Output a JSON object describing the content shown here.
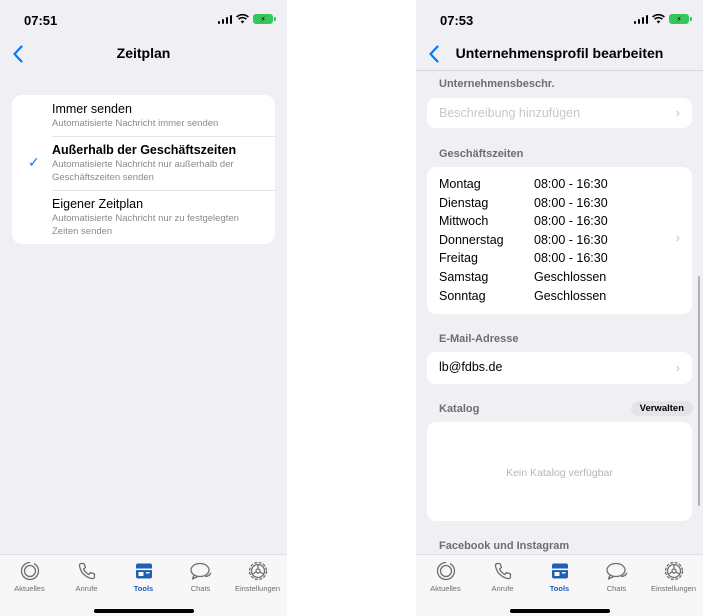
{
  "left": {
    "status": {
      "time": "07:51"
    },
    "nav": {
      "title": "Zeitplan"
    },
    "options": [
      {
        "title": "Immer senden",
        "desc": "Automatisierte Nachricht immer senden",
        "selected": false
      },
      {
        "title": "Außerhalb der Geschäftszeiten",
        "desc": "Automatisierte Nachricht nur außerhalb der Geschäftszeiten senden",
        "selected": true
      },
      {
        "title": "Eigener Zeitplan",
        "desc": "Automatisierte Nachricht nur zu festgelegten Zeiten senden",
        "selected": false
      }
    ]
  },
  "right": {
    "status": {
      "time": "07:53"
    },
    "nav": {
      "title": "Unternehmensprofil bearbeiten"
    },
    "description": {
      "label": "Unternehmensbeschr.",
      "placeholder": "Beschreibung hinzufügen"
    },
    "hours": {
      "label": "Geschäftszeiten",
      "rows": [
        {
          "day": "Montag",
          "time": "08:00 - 16:30"
        },
        {
          "day": "Dienstag",
          "time": "08:00 - 16:30"
        },
        {
          "day": "Mittwoch",
          "time": "08:00 - 16:30"
        },
        {
          "day": "Donnerstag",
          "time": "08:00 - 16:30"
        },
        {
          "day": "Freitag",
          "time": "08:00 - 16:30"
        },
        {
          "day": "Samstag",
          "time": "Geschlossen"
        },
        {
          "day": "Sonntag",
          "time": "Geschlossen"
        }
      ]
    },
    "email": {
      "label": "E-Mail-Adresse",
      "value": "lb@fdbs.de"
    },
    "catalog": {
      "label": "Katalog",
      "manage_label": "Verwalten",
      "empty_text": "Kein Katalog verfügbar"
    },
    "social": {
      "label": "Facebook und Instagram"
    }
  },
  "tabs": [
    {
      "label": "Aktuelles",
      "icon": "updates-icon"
    },
    {
      "label": "Anrufe",
      "icon": "phone-icon"
    },
    {
      "label": "Tools",
      "icon": "tools-icon",
      "active": true
    },
    {
      "label": "Chats",
      "icon": "chats-icon"
    },
    {
      "label": "Einstellungen",
      "icon": "settings-icon"
    }
  ],
  "colors": {
    "accent": "#007aff",
    "active_tab": "#1f5fb4",
    "battery": "#34c759",
    "background": "#efeff4"
  }
}
